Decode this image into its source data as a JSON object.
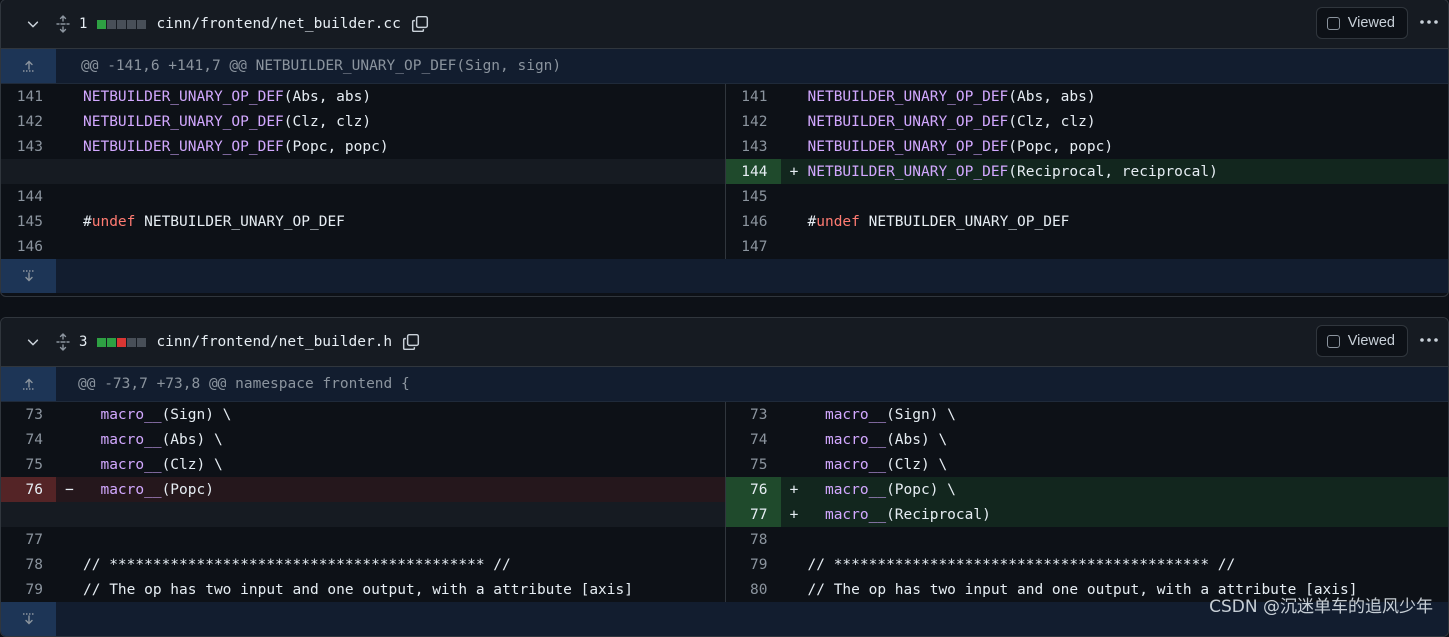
{
  "files": [
    {
      "change_count": "1",
      "blocks": [
        "#2ea043",
        "#484f58",
        "#484f58",
        "#484f58",
        "#484f58"
      ],
      "filename": "cinn/frontend/net_builder.cc",
      "viewed_label": "Viewed",
      "hunk_header": "@@ -141,6 +141,7 @@ NETBUILDER_UNARY_OP_DEF(Sign, sign)",
      "left": [
        {
          "ln": "141",
          "type": "ctx",
          "code": [
            {
              "t": "NETBUILDER_UNARY_OP_DEF",
              "c": "kw"
            },
            {
              "t": "(Abs, abs)",
              "c": ""
            }
          ]
        },
        {
          "ln": "142",
          "type": "ctx",
          "code": [
            {
              "t": "NETBUILDER_UNARY_OP_DEF",
              "c": "kw"
            },
            {
              "t": "(Clz, clz)",
              "c": ""
            }
          ]
        },
        {
          "ln": "143",
          "type": "ctx",
          "code": [
            {
              "t": "NETBUILDER_UNARY_OP_DEF",
              "c": "kw"
            },
            {
              "t": "(Popc, popc)",
              "c": ""
            }
          ]
        },
        {
          "ln": "",
          "type": "empty",
          "code": []
        },
        {
          "ln": "144",
          "type": "ctx",
          "code": []
        },
        {
          "ln": "145",
          "type": "ctx",
          "code": [
            {
              "t": "#",
              "c": ""
            },
            {
              "t": "undef",
              "c": "pp"
            },
            {
              "t": " NETBUILDER_UNARY_OP_DEF",
              "c": ""
            }
          ]
        },
        {
          "ln": "146",
          "type": "ctx",
          "code": []
        }
      ],
      "right": [
        {
          "ln": "141",
          "type": "ctx",
          "code": [
            {
              "t": "NETBUILDER_UNARY_OP_DEF",
              "c": "kw"
            },
            {
              "t": "(Abs, abs)",
              "c": ""
            }
          ]
        },
        {
          "ln": "142",
          "type": "ctx",
          "code": [
            {
              "t": "NETBUILDER_UNARY_OP_DEF",
              "c": "kw"
            },
            {
              "t": "(Clz, clz)",
              "c": ""
            }
          ]
        },
        {
          "ln": "143",
          "type": "ctx",
          "code": [
            {
              "t": "NETBUILDER_UNARY_OP_DEF",
              "c": "kw"
            },
            {
              "t": "(Popc, popc)",
              "c": ""
            }
          ]
        },
        {
          "ln": "144",
          "type": "add",
          "code": [
            {
              "t": "NETBUILDER_UNARY_OP_DEF",
              "c": "kw"
            },
            {
              "t": "(Reciprocal, reciprocal)",
              "c": ""
            }
          ]
        },
        {
          "ln": "145",
          "type": "ctx",
          "code": []
        },
        {
          "ln": "146",
          "type": "ctx",
          "code": [
            {
              "t": "#",
              "c": ""
            },
            {
              "t": "undef",
              "c": "pp"
            },
            {
              "t": " NETBUILDER_UNARY_OP_DEF",
              "c": ""
            }
          ]
        },
        {
          "ln": "147",
          "type": "ctx",
          "code": []
        }
      ]
    },
    {
      "change_count": "3",
      "blocks": [
        "#2ea043",
        "#2ea043",
        "#da3633",
        "#484f58",
        "#484f58"
      ],
      "filename": "cinn/frontend/net_builder.h",
      "viewed_label": "Viewed",
      "hunk_header": "@@ -73,7 +73,8 @@ namespace frontend {",
      "left": [
        {
          "ln": "73",
          "type": "ctx",
          "code": [
            {
              "t": "  ",
              "c": ""
            },
            {
              "t": "macro__",
              "c": "kw"
            },
            {
              "t": "(Sign) \\",
              "c": ""
            }
          ]
        },
        {
          "ln": "74",
          "type": "ctx",
          "code": [
            {
              "t": "  ",
              "c": ""
            },
            {
              "t": "macro__",
              "c": "kw"
            },
            {
              "t": "(Abs) \\",
              "c": ""
            }
          ]
        },
        {
          "ln": "75",
          "type": "ctx",
          "code": [
            {
              "t": "  ",
              "c": ""
            },
            {
              "t": "macro__",
              "c": "kw"
            },
            {
              "t": "(Clz) \\",
              "c": ""
            }
          ]
        },
        {
          "ln": "76",
          "type": "del",
          "code": [
            {
              "t": "  ",
              "c": ""
            },
            {
              "t": "macro__",
              "c": "kw"
            },
            {
              "t": "(Popc)",
              "c": ""
            }
          ]
        },
        {
          "ln": "",
          "type": "empty",
          "code": []
        },
        {
          "ln": "77",
          "type": "ctx",
          "code": []
        },
        {
          "ln": "78",
          "type": "ctx",
          "code": [
            {
              "t": "// ******************************************* //",
              "c": ""
            }
          ]
        },
        {
          "ln": "79",
          "type": "ctx",
          "code": [
            {
              "t": "// The op has two input and one output, with a attribute [axis]",
              "c": ""
            }
          ]
        }
      ],
      "right": [
        {
          "ln": "73",
          "type": "ctx",
          "code": [
            {
              "t": "  ",
              "c": ""
            },
            {
              "t": "macro__",
              "c": "kw"
            },
            {
              "t": "(Sign) \\",
              "c": ""
            }
          ]
        },
        {
          "ln": "74",
          "type": "ctx",
          "code": [
            {
              "t": "  ",
              "c": ""
            },
            {
              "t": "macro__",
              "c": "kw"
            },
            {
              "t": "(Abs) \\",
              "c": ""
            }
          ]
        },
        {
          "ln": "75",
          "type": "ctx",
          "code": [
            {
              "t": "  ",
              "c": ""
            },
            {
              "t": "macro__",
              "c": "kw"
            },
            {
              "t": "(Clz) \\",
              "c": ""
            }
          ]
        },
        {
          "ln": "76",
          "type": "add",
          "code": [
            {
              "t": "  ",
              "c": ""
            },
            {
              "t": "macro__",
              "c": "kw"
            },
            {
              "t": "(Popc) \\",
              "c": ""
            }
          ]
        },
        {
          "ln": "77",
          "type": "add",
          "code": [
            {
              "t": "  ",
              "c": ""
            },
            {
              "t": "macro__",
              "c": "kw"
            },
            {
              "t": "(Reciprocal)",
              "c": ""
            }
          ]
        },
        {
          "ln": "78",
          "type": "ctx",
          "code": []
        },
        {
          "ln": "79",
          "type": "ctx",
          "code": [
            {
              "t": "// ******************************************* //",
              "c": ""
            }
          ]
        },
        {
          "ln": "80",
          "type": "ctx",
          "code": [
            {
              "t": "// The op has two input and one output, with a attribute [axis]",
              "c": ""
            }
          ]
        }
      ]
    }
  ],
  "watermark": "CSDN @沉迷单车的追风少年"
}
